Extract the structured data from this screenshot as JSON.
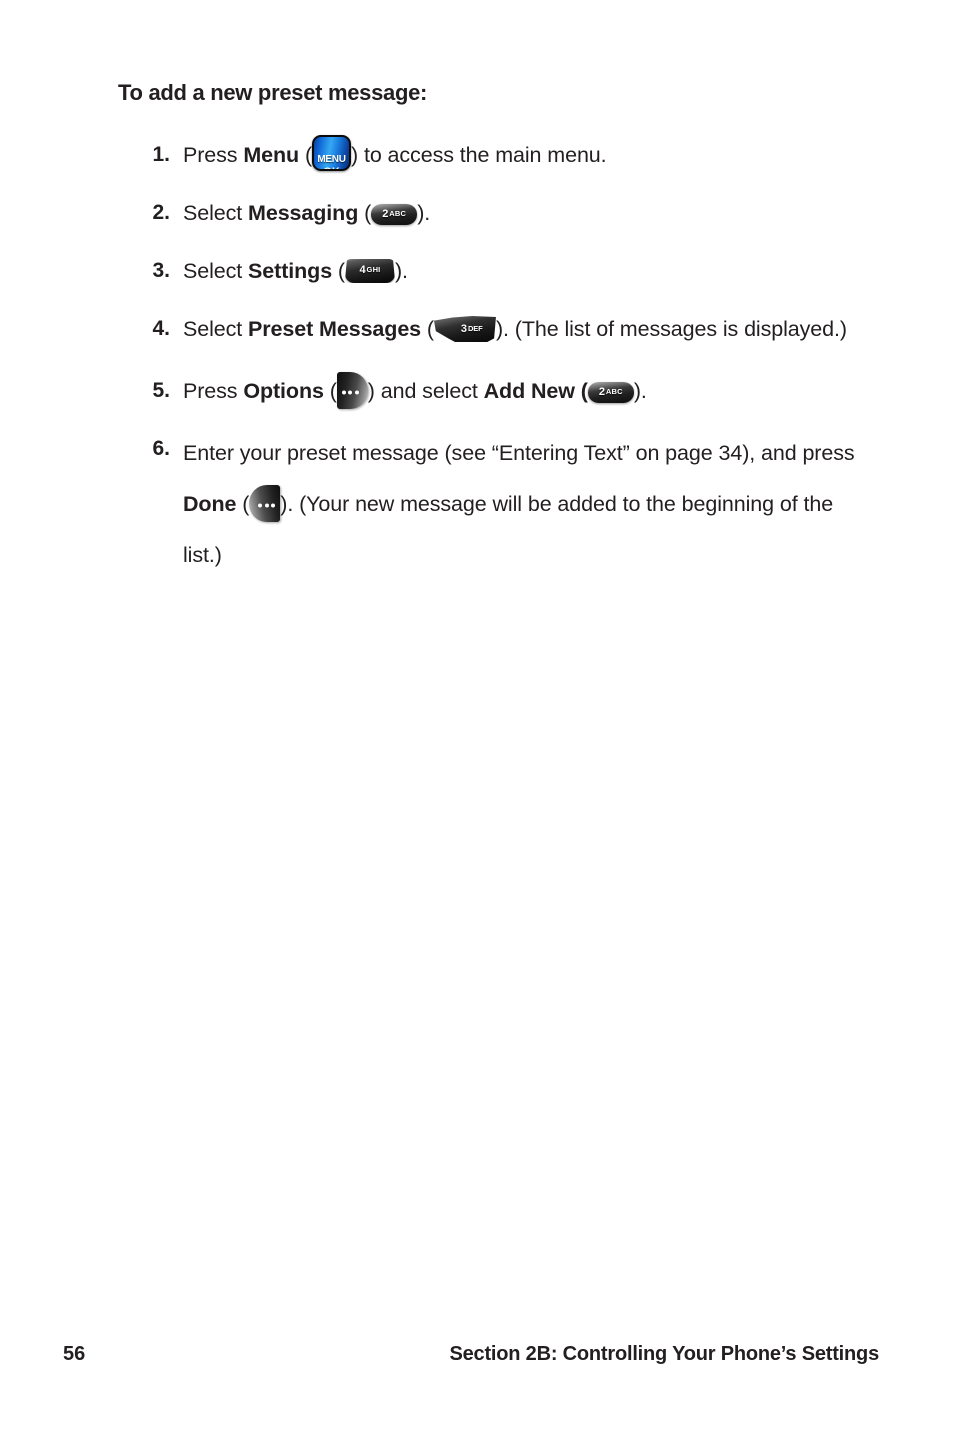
{
  "heading": "To add a new preset message:",
  "steps": [
    {
      "num": "1.",
      "pre": "Press ",
      "bold1": "Menu",
      "mid1": " (",
      "icon": "menu-ok-key",
      "post": ") to access the main menu."
    },
    {
      "num": "2.",
      "pre": "Select ",
      "bold1": "Messaging",
      "mid1": " (",
      "icon": "key-2-abc",
      "post": ")."
    },
    {
      "num": "3.",
      "pre": "Select ",
      "bold1": "Settings",
      "mid1": " (",
      "icon": "key-4-ghi",
      "post": ")."
    },
    {
      "num": "4.",
      "pre": "Select ",
      "bold1": "Preset Messages",
      "mid1": " (",
      "icon": "key-3-def",
      "post": "). (The list of messages is displayed.)"
    },
    {
      "num": "5.",
      "pre": "Press ",
      "bold1": "Options",
      "mid1": " (",
      "icon": "soft-key-left-options",
      "mid2": ") and select ",
      "bold2": "Add New (",
      "icon2": "key-2-abc",
      "post": ")."
    },
    {
      "num": "6.",
      "pre": "Enter your preset message (see “Entering Text” on page 34), and press ",
      "bold1": "Done",
      "mid1": " (",
      "icon": "soft-key-right-done",
      "post": "). (Your new message will be added to the beginning of the list.)"
    }
  ],
  "keys": {
    "menu_ok": {
      "line1": "MENU",
      "line2": "OK"
    },
    "k2": {
      "digit": "2",
      "letters": "ABC"
    },
    "k3": {
      "digit": "3",
      "letters": "DEF"
    },
    "k4": {
      "digit": "4",
      "letters": "GHI"
    }
  },
  "footer": {
    "page_number": "56",
    "section": "Section 2B: Controlling Your Phone’s Settings"
  },
  "colors": {
    "text": "#231f20",
    "menu_key_blue": "#1b7fe0",
    "key_dark": "#1a1a1a",
    "page_background": "#ffffff"
  }
}
